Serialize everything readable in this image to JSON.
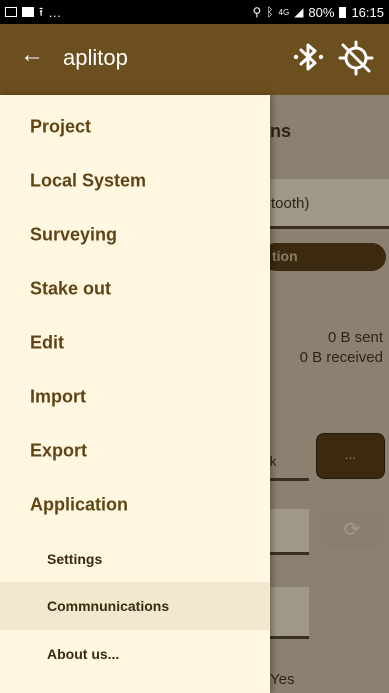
{
  "status_bar": {
    "notif_icons": [
      "image-icon",
      "screen-icon",
      "upload-icon"
    ],
    "ellipsis": "…",
    "network": "4G",
    "battery": "80%",
    "time": "16:15",
    "right_icons": [
      "location-icon",
      "bluetooth-icon",
      "signal-icon",
      "battery-icon"
    ]
  },
  "app_bar": {
    "back_icon": "←",
    "title": "aplitop",
    "actions": [
      "bluetooth-icon",
      "gps-off-icon"
    ],
    "color": "#6b4f1f"
  },
  "drawer": {
    "items": [
      {
        "label": "Project"
      },
      {
        "label": "Local System"
      },
      {
        "label": "Surveying"
      },
      {
        "label": "Stake out"
      },
      {
        "label": "Edit"
      },
      {
        "label": "Import"
      },
      {
        "label": "Export"
      },
      {
        "label": "Application"
      }
    ],
    "subitems": [
      {
        "label": "Settings",
        "active": false
      },
      {
        "label": "Commnunications",
        "active": true
      },
      {
        "label": "About us...",
        "active": false
      }
    ],
    "background": "#fff7df",
    "text_color": "#5e4416"
  },
  "background_screen": {
    "heading_fragment": "ns",
    "bluetooth_field_fragment": "tooth)",
    "connect_button_fragment": "tion",
    "sent": "0 B sent",
    "received": "0 B received",
    "network_fragment": "rk",
    "more_button": "...",
    "refresh_icon": "refresh-icon",
    "yes_fragment": "Yes"
  }
}
